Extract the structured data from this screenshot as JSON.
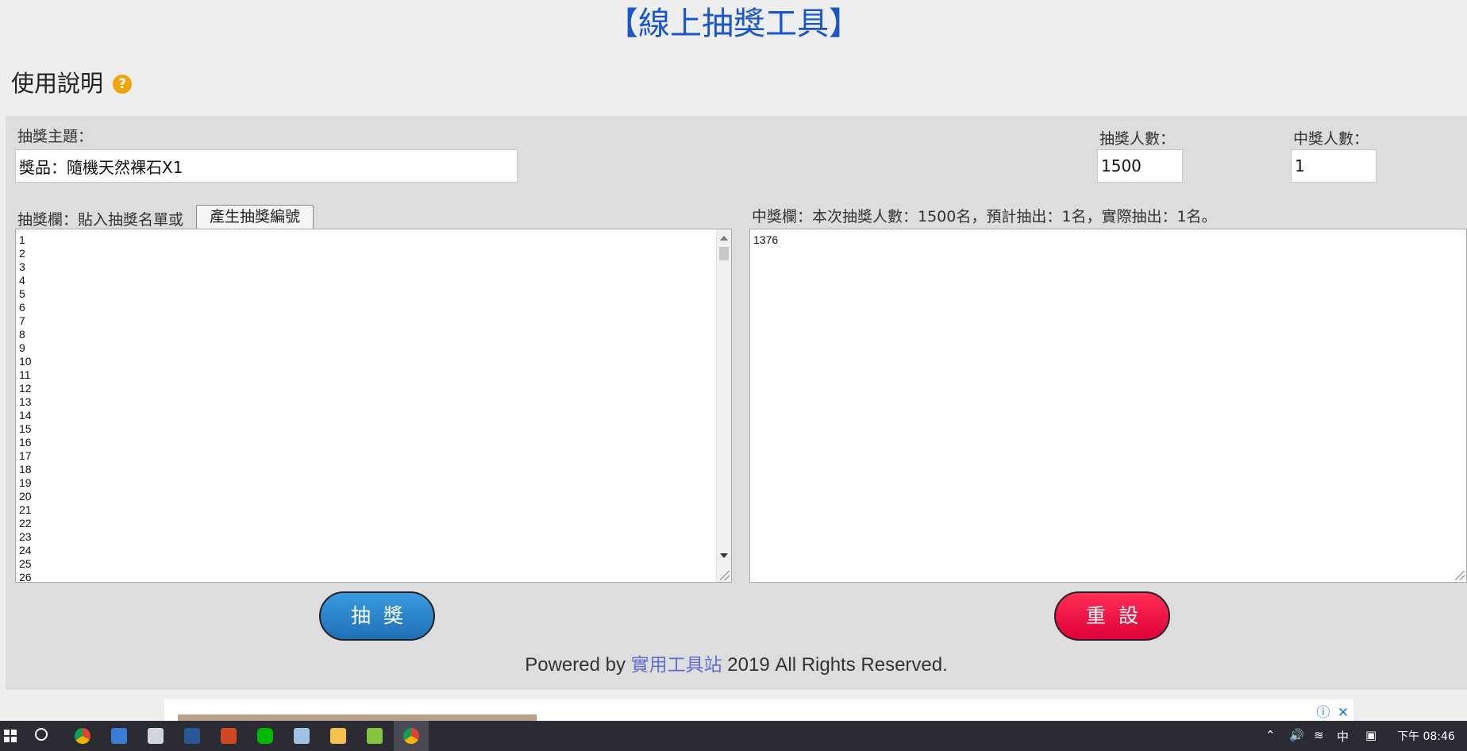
{
  "page": {
    "title": "【線上抽獎工具】",
    "help_label": "使用說明",
    "help_icon": "question-icon"
  },
  "form": {
    "topic_label": "抽獎主題：",
    "topic_value": "獎品：隨機天然裸石X1",
    "participants_label": "抽獎人數：",
    "participants_value": "1500",
    "winners_label": "中獎人數：",
    "winners_value": "1"
  },
  "entries": {
    "label": "抽獎欄：貼入抽獎名單或",
    "generate_button": "產生抽獎編號",
    "visible_lines": [
      "1",
      "2",
      "3",
      "4",
      "5",
      "6",
      "7",
      "8",
      "9",
      "10",
      "11",
      "12",
      "13",
      "14",
      "15",
      "16",
      "17",
      "18",
      "19",
      "20",
      "21",
      "22",
      "23",
      "24",
      "25",
      "26"
    ]
  },
  "winners_box": {
    "label": "中獎欄：本次抽獎人數：1500名，預計抽出：1名，實際抽出：1名。",
    "content": "1376"
  },
  "buttons": {
    "draw": "抽獎",
    "reset": "重設"
  },
  "footer": {
    "prefix": "Powered by ",
    "site": "實用工具站",
    "suffix": " 2019 All Rights Reserved."
  },
  "ad": {
    "info_icon": "ⓘ",
    "close_icon": "✕"
  },
  "taskbar": {
    "ime": "中",
    "clock": "下午 08:46"
  },
  "colors": {
    "title": "#1a56c9",
    "draw_button": "#2a86d1",
    "reset_button": "#f2063f",
    "help_icon": "#f0a30a",
    "link": "#5f6fd0"
  }
}
